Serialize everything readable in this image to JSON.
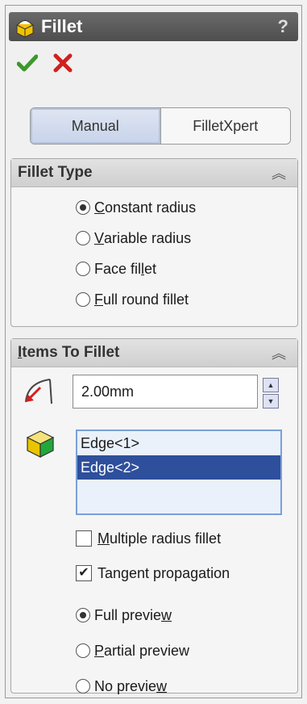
{
  "window": {
    "title": "Fillet",
    "help": "?"
  },
  "tabs": [
    {
      "label": "Manual"
    },
    {
      "label": "FilletXpert"
    }
  ],
  "fillet_type": {
    "header": "Fillet Type",
    "options": [
      {
        "pre": "",
        "u": "C",
        "post": "onstant radius",
        "selected": true
      },
      {
        "pre": "",
        "u": "V",
        "post": "ariable radius",
        "selected": false
      },
      {
        "pre": "Face fil",
        "u": "l",
        "post": "et",
        "selected": false
      },
      {
        "pre": "",
        "u": "F",
        "post": "ull round fillet",
        "selected": false
      }
    ]
  },
  "items_to_fillet": {
    "header_u": "I",
    "header_rest": "tems To Fillet",
    "radius_value": "2.00mm",
    "edges": [
      {
        "label": "Edge<1>",
        "selected": false
      },
      {
        "label": "Edge<2>",
        "selected": true
      }
    ],
    "multiple_radius": {
      "pre": "",
      "u": "M",
      "post": "ultiple radius fillet",
      "checked": false
    },
    "tangent": {
      "pre": "Tangent propagation",
      "checked": true
    },
    "preview": [
      {
        "pre": "Full previe",
        "u": "w",
        "post": "",
        "selected": true
      },
      {
        "pre": "",
        "u": "P",
        "post": "artial preview",
        "selected": false
      },
      {
        "pre": "No previe",
        "u": "w",
        "post": "",
        "selected": false
      }
    ]
  },
  "colors": {
    "title_bar": "#555555",
    "selection": "#2e4f9c",
    "ok": "#3a9a2a",
    "cancel": "#d02020"
  }
}
